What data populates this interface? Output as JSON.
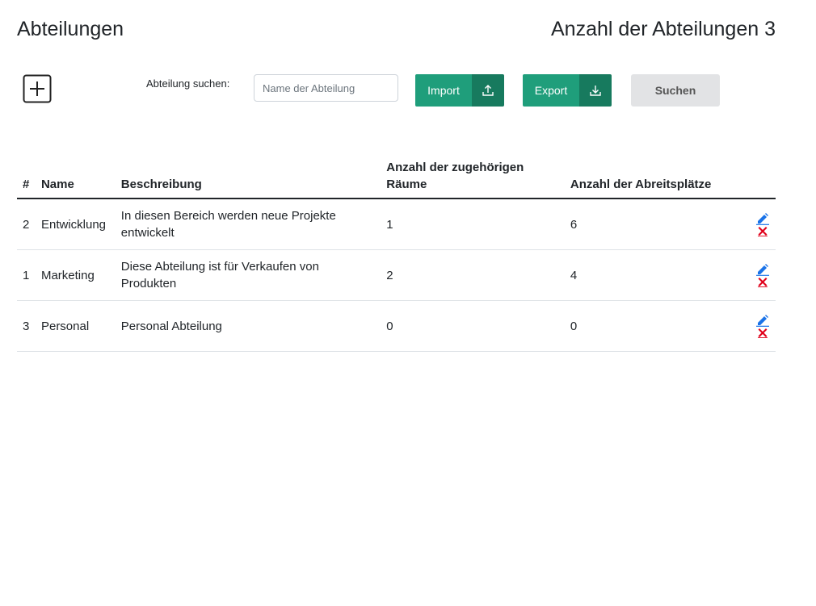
{
  "header": {
    "title": "Abteilungen",
    "count_title": "Anzahl der Abteilungen 3"
  },
  "search": {
    "label": "Abteilung suchen:",
    "placeholder": "Name der Abteilung",
    "value": ""
  },
  "toolbar": {
    "import_label": "Import",
    "export_label": "Export",
    "search_label": "Suchen"
  },
  "colors": {
    "accent": "#1f9e7b",
    "accent_dark": "#177a5e",
    "edit_icon": "#1a73e8",
    "delete_icon": "#e0001a"
  },
  "icons": {
    "add": "plus-square-icon",
    "import": "upload-icon",
    "export": "download-icon",
    "edit": "pencil-icon",
    "delete": "x-icon"
  },
  "table": {
    "headers": {
      "id": "#",
      "name": "Name",
      "description": "Beschreibung",
      "rooms": "Anzahl der zugehörigen Räume",
      "workplaces": "Anzahl der Abreitsplätze"
    },
    "rows": [
      {
        "id": "2",
        "name": "Entwicklung",
        "description": "In diesen Bereich werden neue Projekte entwickelt",
        "rooms": "1",
        "workplaces": "6"
      },
      {
        "id": "1",
        "name": "Marketing",
        "description": "Diese Abteilung ist für Verkaufen von Produkten",
        "rooms": "2",
        "workplaces": "4"
      },
      {
        "id": "3",
        "name": "Personal",
        "description": "Personal Abteilung",
        "rooms": "0",
        "workplaces": "0"
      }
    ]
  }
}
